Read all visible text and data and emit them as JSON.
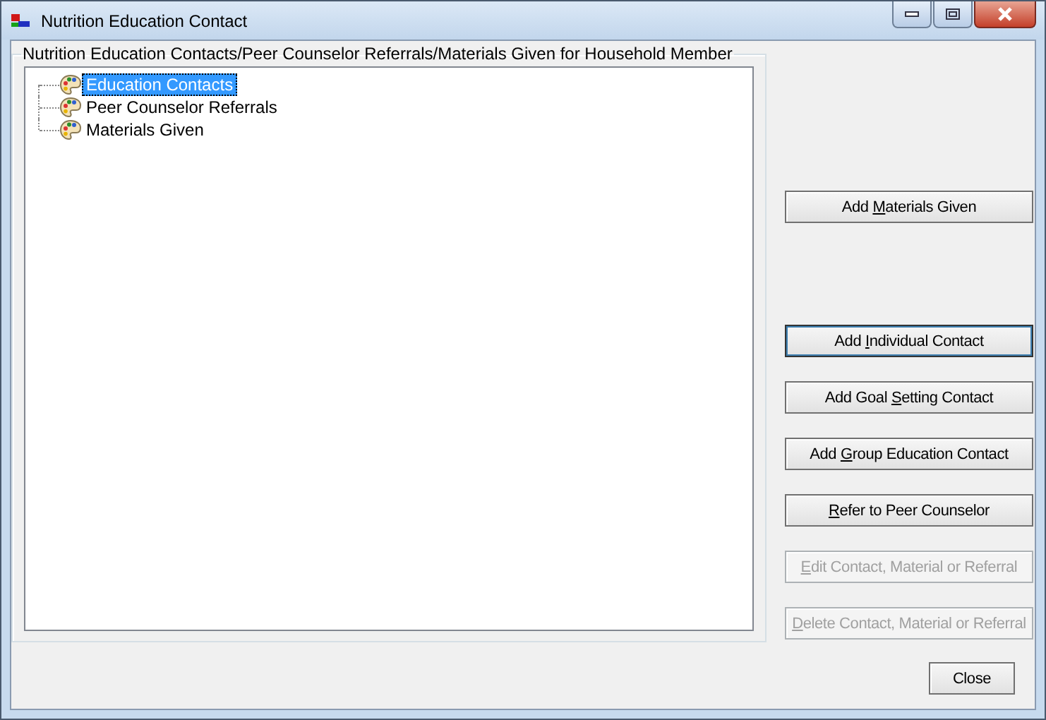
{
  "window": {
    "title": "Nutrition Education Contact"
  },
  "group": {
    "title": "Nutrition Education Contacts/Peer Counselor Referrals/Materials Given for Household Member"
  },
  "tree": {
    "items": [
      {
        "label": "Education Contacts",
        "selected": true
      },
      {
        "label": "Peer Counselor Referrals",
        "selected": false
      },
      {
        "label": "Materials Given",
        "selected": false
      }
    ]
  },
  "buttons": [
    {
      "pre": "Add ",
      "key": "M",
      "post": "aterials Given",
      "disabled": false,
      "default": false
    },
    {
      "pre": "Add ",
      "key": "I",
      "post": "ndividual Contact",
      "disabled": false,
      "default": true
    },
    {
      "pre": "Add Goal ",
      "key": "S",
      "post": "etting Contact",
      "disabled": false,
      "default": false
    },
    {
      "pre": "Add ",
      "key": "G",
      "post": "roup Education Contact",
      "disabled": false,
      "default": false
    },
    {
      "key": "R",
      "post": "efer to Peer Counselor",
      "disabled": false,
      "default": false
    },
    {
      "key": "E",
      "post": "dit Contact, Material or Referral",
      "disabled": true,
      "default": false
    },
    {
      "key": "D",
      "post": "elete Contact, Material or Referral",
      "disabled": true,
      "default": false
    }
  ],
  "close_button": {
    "label": "Close"
  }
}
